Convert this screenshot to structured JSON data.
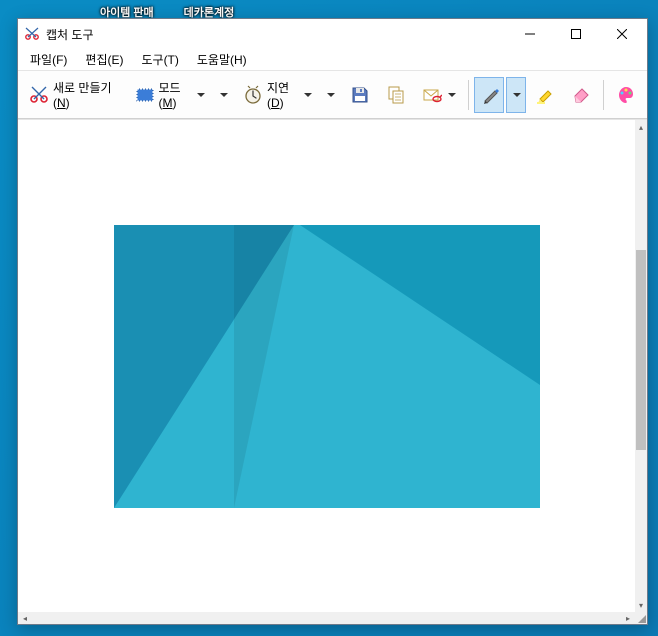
{
  "desktop": {
    "icons": [
      "아이템 판매",
      "데카론계정"
    ]
  },
  "window": {
    "title": "캡처 도구"
  },
  "menubar": {
    "file": "파일(F)",
    "edit": "편집(E)",
    "tools": "도구(T)",
    "help": "도움말(H)"
  },
  "toolbar": {
    "new_label": "새로 만들기(",
    "new_hotkey": "N",
    "new_label_suffix": ")",
    "mode_label": "모드(",
    "mode_hotkey": "M",
    "mode_suffix": ")",
    "delay_label": "지연(",
    "delay_hotkey": "D",
    "delay_suffix": ")"
  },
  "icons": {
    "scissors": "scissors",
    "rect_mode": "rect",
    "clock": "clock",
    "save": "save",
    "copy": "copy",
    "mail": "mail",
    "pen": "pen",
    "highlighter": "highlighter",
    "eraser": "eraser",
    "paint3d": "paint3d"
  }
}
